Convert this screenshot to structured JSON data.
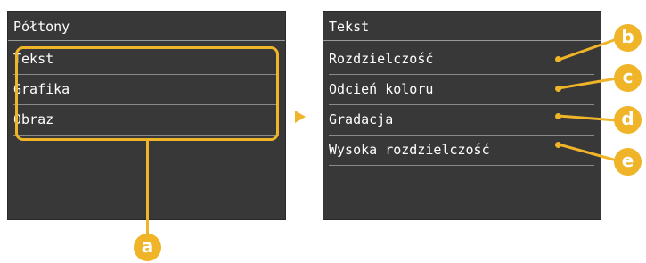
{
  "left_screen": {
    "title": "Półtony",
    "items": [
      {
        "label": "Tekst"
      },
      {
        "label": "Grafika"
      },
      {
        "label": "Obraz"
      }
    ]
  },
  "right_screen": {
    "title": "Tekst",
    "items": [
      {
        "label": "Rozdzielczość"
      },
      {
        "label": "Odcień koloru"
      },
      {
        "label": "Gradacja"
      },
      {
        "label": "Wysoka rozdzielczość"
      }
    ]
  },
  "markers": {
    "a": "a",
    "b": "b",
    "c": "c",
    "d": "d",
    "e": "e"
  },
  "colors": {
    "accent": "#f0b429",
    "screen_bg": "#383838",
    "text": "#ffffff"
  }
}
